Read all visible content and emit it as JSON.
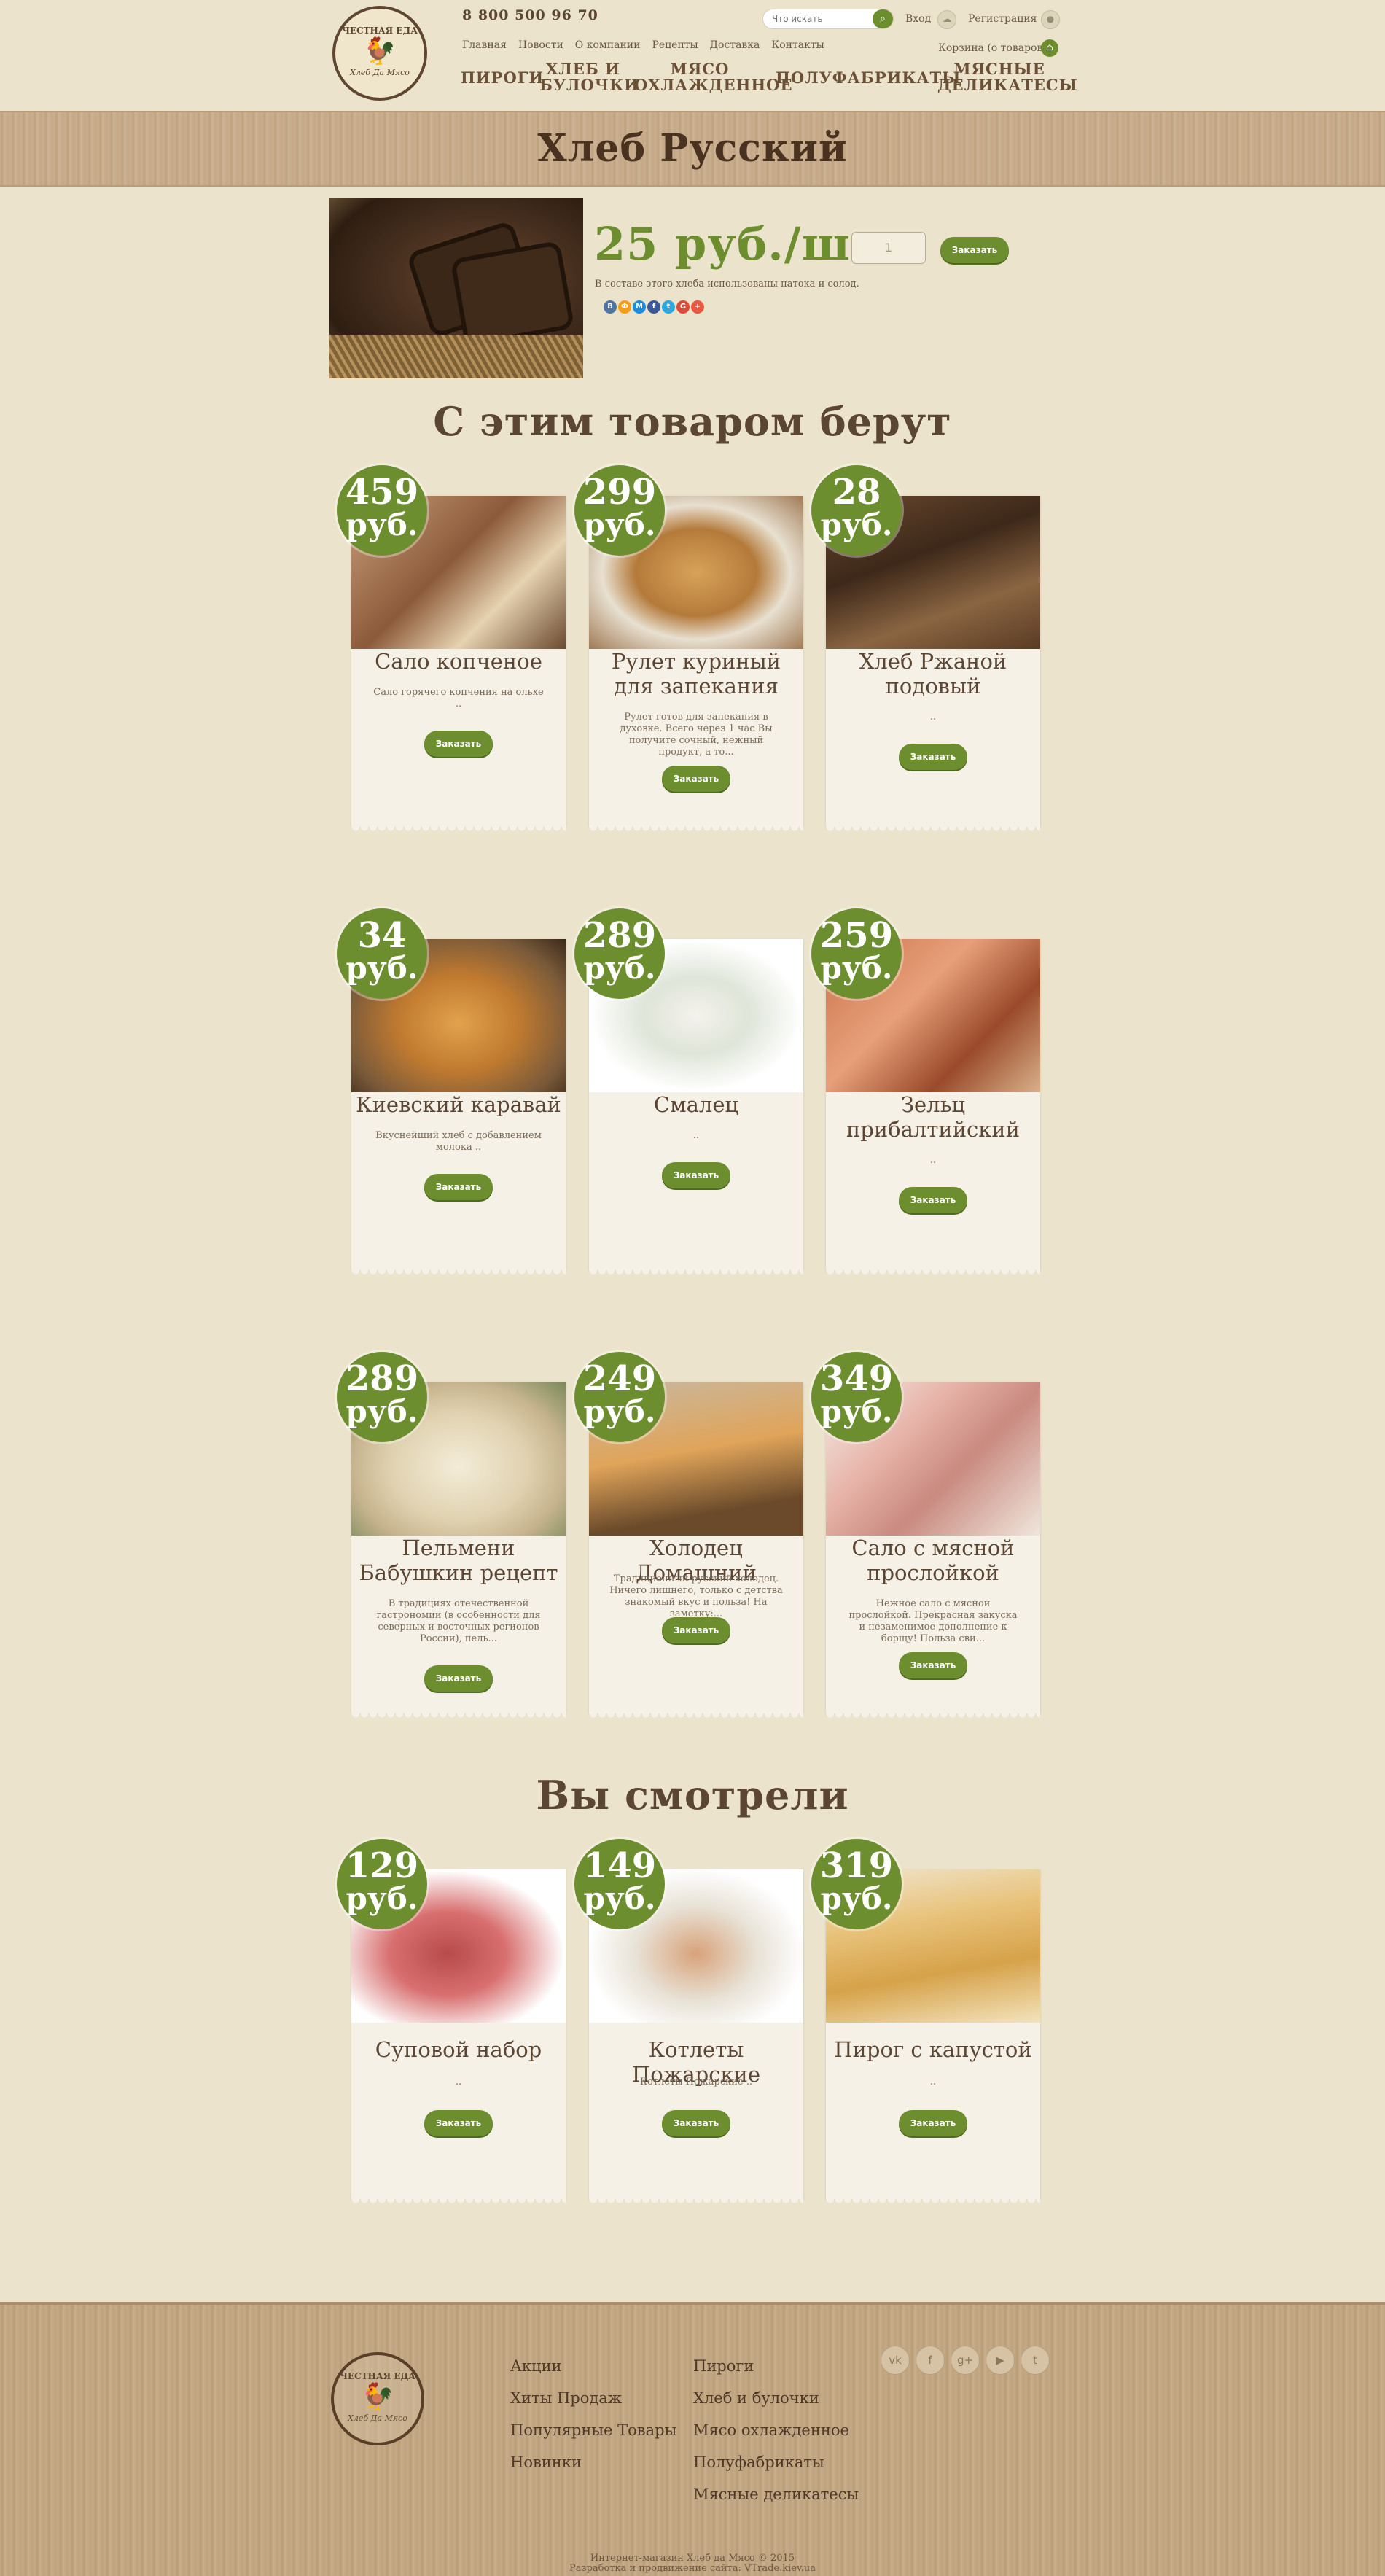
{
  "header": {
    "logo_top": "ЧЕСТНАЯ ЕДА",
    "logo_bottom": "Хлеб Да Мясо",
    "phone": "8 800 500 96 70",
    "topnav": [
      "Главная",
      "Новости",
      "О компании",
      "Рецепты",
      "Доставка",
      "Контакты"
    ],
    "search_placeholder": "Что искать",
    "login": "Вход",
    "register": "Регистрация",
    "cart": "Корзина (о товаров)",
    "mainnav": [
      "ПИРОГИ",
      "ХЛЕБ И БУЛОЧКИ",
      "МЯСО ОХЛАЖДЕННОЕ",
      "ПОЛУФАБРИКАТЫ",
      "МЯСНЫЕ ДЕЛИКАТЕСЫ"
    ]
  },
  "product": {
    "title": "Хлеб Русский",
    "price": "25 руб./шт",
    "qty": "1",
    "order_label": "Заказать",
    "description": "В составе этого хлеба использованы патока и солод.",
    "social": [
      "В",
      "Ф",
      "M",
      "f",
      "t",
      "G",
      "+"
    ],
    "social_colors": [
      "#4c75a3",
      "#f59c1a",
      "#168de2",
      "#3b5998",
      "#2ca7e0",
      "#dd4b39",
      "#e9573f"
    ]
  },
  "section_related": "С этим товаром берут",
  "section_viewed": "Вы смотрели",
  "related": [
    {
      "price": "459",
      "unit": "руб.",
      "name": "Сало копченое",
      "desc": "Сало горячего копчения на ольхе ..",
      "btn": "Заказать"
    },
    {
      "price": "299",
      "unit": "руб.",
      "name": "Рулет куриный для запекания",
      "desc": "Рулет готов для запекания в духовке. Всего через 1 час Вы получите сочный, нежный продукт, а то...",
      "btn": "Заказать"
    },
    {
      "price": "28",
      "unit": "руб.",
      "name": "Хлеб Ржаной подовый",
      "desc": "..",
      "btn": "Заказать"
    },
    {
      "price": "34",
      "unit": "руб.",
      "name": "Киевский каравай",
      "desc": "Вкуснейший хлеб с добавлением молока ..",
      "btn": "Заказать"
    },
    {
      "price": "289",
      "unit": "руб.",
      "name": "Смалец",
      "desc": "..",
      "btn": "Заказать"
    },
    {
      "price": "259",
      "unit": "руб.",
      "name": "Зельц прибалтийский",
      "desc": "..",
      "btn": "Заказать"
    },
    {
      "price": "289",
      "unit": "руб.",
      "name": "Пельмени Бабушкин рецепт",
      "desc": "В традициях отечественной гастрономии (в особенности для северных и восточных регионов России), пель...",
      "btn": "Заказать"
    },
    {
      "price": "249",
      "unit": "руб.",
      "name": "Холодец Домашний",
      "desc": "Традиционный русский холодец. Ничего лишнего, только с детства знакомый вкус и польза! На заметку:...",
      "btn": "Заказать"
    },
    {
      "price": "349",
      "unit": "руб.",
      "name": "Сало с мясной прослойкой",
      "desc": "Нежное сало с мясной прослойкой. Прекрасная закуска и незаменимое дополнение к борщу! Польза сви...",
      "btn": "Заказать"
    }
  ],
  "viewed": [
    {
      "price": "129",
      "unit": "руб.",
      "name": "Суповой набор",
      "desc": "..",
      "btn": "Заказать"
    },
    {
      "price": "149",
      "unit": "руб.",
      "name": "Котлеты Пожарские",
      "desc": "Котлеты Пожарские ..",
      "btn": "Заказать"
    },
    {
      "price": "319",
      "unit": "руб.",
      "name": "Пирог с капустой",
      "desc": "..",
      "btn": "Заказать"
    }
  ],
  "footer": {
    "col1": [
      "Акции",
      "Хиты Продаж",
      "Популярные Товары",
      "Новинки"
    ],
    "col2": [
      "Пироги",
      "Хлеб и булочки",
      "Мясо охлажденное",
      "Полуфабрикаты",
      "Мясные деликатесы"
    ],
    "social": [
      "vk",
      "f",
      "g+",
      "yt",
      "tw"
    ],
    "copy1": "Интернет-магазин Хлеб да Мясо © 2015",
    "copy2": "Разработка и продвижение сайта: VTrade.kiev.ua"
  }
}
